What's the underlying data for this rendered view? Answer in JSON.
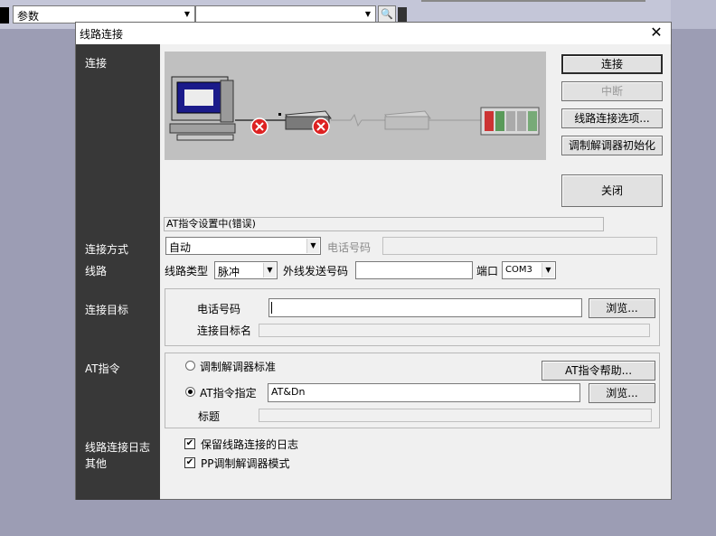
{
  "toolbar": {
    "combo1_value": "参数",
    "combo2_value": "",
    "tool_icon": "search-icon"
  },
  "dialog": {
    "title": "线路连接",
    "close_glyph": "✕",
    "left_labels": {
      "connect": "连接",
      "connect_method": "连接方式",
      "line": "线路",
      "target": "连接目标",
      "at_command": "AT指令",
      "log": "线路连接日志",
      "other": "其他"
    },
    "buttons": {
      "connect": "连接",
      "disconnect": "中断",
      "line_options": "线路连接选项...",
      "modem_init": "调制解调器初始化",
      "close": "关闭",
      "browse1": "浏览...",
      "at_help": "AT指令帮助...",
      "browse2": "浏览..."
    },
    "status_text": "AT指令设置中(错误)",
    "connect_method": {
      "value": "自动",
      "phone_label": "电话号码",
      "phone_value": ""
    },
    "line": {
      "type_label": "线路类型",
      "type_value": "脉冲",
      "outside_label": "外线发送号码",
      "outside_value": "",
      "port_label": "端口",
      "port_value": "COM3"
    },
    "target": {
      "phone_label": "电话号码",
      "phone_value": "",
      "name_label": "连接目标名",
      "name_value": ""
    },
    "at": {
      "standard_label": "调制解调器标准",
      "custom_label": "AT指令指定",
      "custom_value": "AT&Dn",
      "title_label": "标题",
      "title_value": ""
    },
    "checks": {
      "keep_log": "保留线路连接的日志",
      "pp_mode": "PP调制解调器模式",
      "mark": "✔"
    }
  }
}
